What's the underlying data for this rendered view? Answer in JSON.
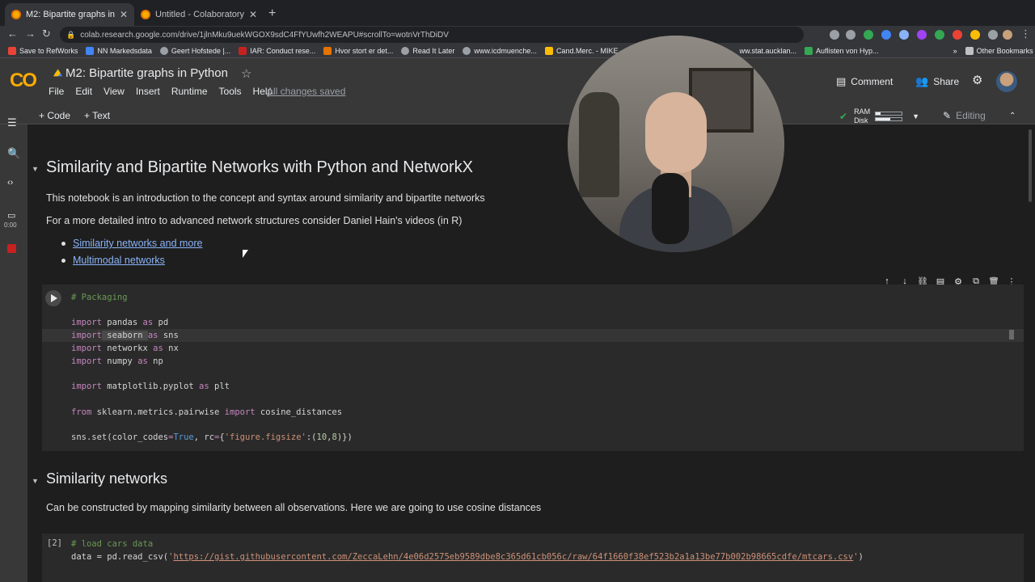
{
  "browser": {
    "tabs": [
      {
        "title": "M2: Bipartite graphs in Python",
        "active": true
      },
      {
        "title": "Untitled - Colaboratory",
        "active": false
      }
    ],
    "close_glyph": "✕",
    "new_tab_glyph": "+",
    "url": "colab.research.google.com/drive/1jlnMku9uekWGOX9sdC4FfYUwfh2WEAPU#scrollTo=wotnVrThDiDV",
    "nav": {
      "back": "←",
      "forward": "→",
      "reload": "↻"
    },
    "bookmarks": [
      "Save to RefWorks",
      "NN Markedsdata",
      "Geert Hofstede |...",
      "IAR: Conduct rese...",
      "Hvor stort er det...",
      "Read It Later",
      "www.icdmuenche...",
      "Cand.Merc. - MIKE",
      "ww.stat.aucklan...",
      "Auflisten von Hyp..."
    ],
    "bookmarks_overflow": "»",
    "other_bookmarks": "Other Bookmarks"
  },
  "colab": {
    "logo": "CO",
    "title": "M2: Bipartite graphs in Python",
    "star": "☆",
    "menu": [
      "File",
      "Edit",
      "View",
      "Insert",
      "Runtime",
      "Tools",
      "Help"
    ],
    "save_status": "All changes saved",
    "comment_label": "Comment",
    "share_label": "Share",
    "toolbar": {
      "add_code": "+ Code",
      "add_text": "+ Text"
    },
    "resources": {
      "ram_label": "RAM",
      "disk_label": "Disk",
      "ram_fraction": 0.2,
      "disk_fraction": 0.55,
      "check": "✔"
    },
    "editing_label": "Editing",
    "sidebar_timer": "0:00"
  },
  "notebook": {
    "section1": {
      "title": "Similarity and Bipartite Networks with Python and NetworkX",
      "intro": "This notebook is an introduction to the concept and syntax around similarity and bipartite networks",
      "intro2": "For a more detailed intro to advanced network structures consider Daniel Hain's videos (in R)",
      "links": [
        "Similarity networks and more",
        "Multimodal networks"
      ]
    },
    "cell1": {
      "comment": "# Packaging",
      "lines": {
        "l1a": "import",
        "l1b": " pandas ",
        "l1c": "as",
        "l1d": " pd",
        "l2a": "import",
        "l2b": " seaborn ",
        "l2c": "as",
        "l2d": " sns",
        "l3a": "import",
        "l3b": " networkx ",
        "l3c": "as",
        "l3d": " nx",
        "l4a": "import",
        "l4b": " numpy ",
        "l4c": "as",
        "l4d": " np",
        "l5a": "import",
        "l5b": " matplotlib.pyplot ",
        "l5c": "as",
        "l5d": " plt",
        "l6a": "from",
        "l6b": " sklearn.metrics.pairwise ",
        "l6c": "import",
        "l6d": " cosine_distances",
        "l7a": "sns.set(color_codes",
        "l7b": "=",
        "l7c": "True",
        "l7d": ", rc",
        "l7e": "=",
        "l7f": "{",
        "l7g": "'figure.figsize'",
        "l7h": ":(",
        "l7i": "10",
        "l7j": ",",
        "l7k": "8",
        "l7l": ")})"
      }
    },
    "section2": {
      "title": "Similarity networks",
      "text": "Can be constructed by mapping similarity between all observations. Here we are going to use cosine distances"
    },
    "cell2": {
      "exec_count": "[2]",
      "comment": "# load cars data",
      "line_a": "data = pd.read_csv(",
      "line_q1": "'",
      "url": "https://gist.githubusercontent.com/ZeccaLehn/4e06d2575eb9589dbe8c365d61cb056c/raw/64f1660f38ef523b2a1a13be77b002b98665cdfe/mtcars.csv",
      "line_q2": "'",
      "line_b": ")"
    },
    "cell_tools": [
      "↑",
      "↓",
      "⛓",
      "▤",
      "⚙",
      "⧉",
      "🗑",
      "⋮"
    ]
  },
  "icons": {
    "sidebar": [
      "☰",
      "🔍",
      "‹›",
      "▭"
    ],
    "caret": "▼"
  }
}
